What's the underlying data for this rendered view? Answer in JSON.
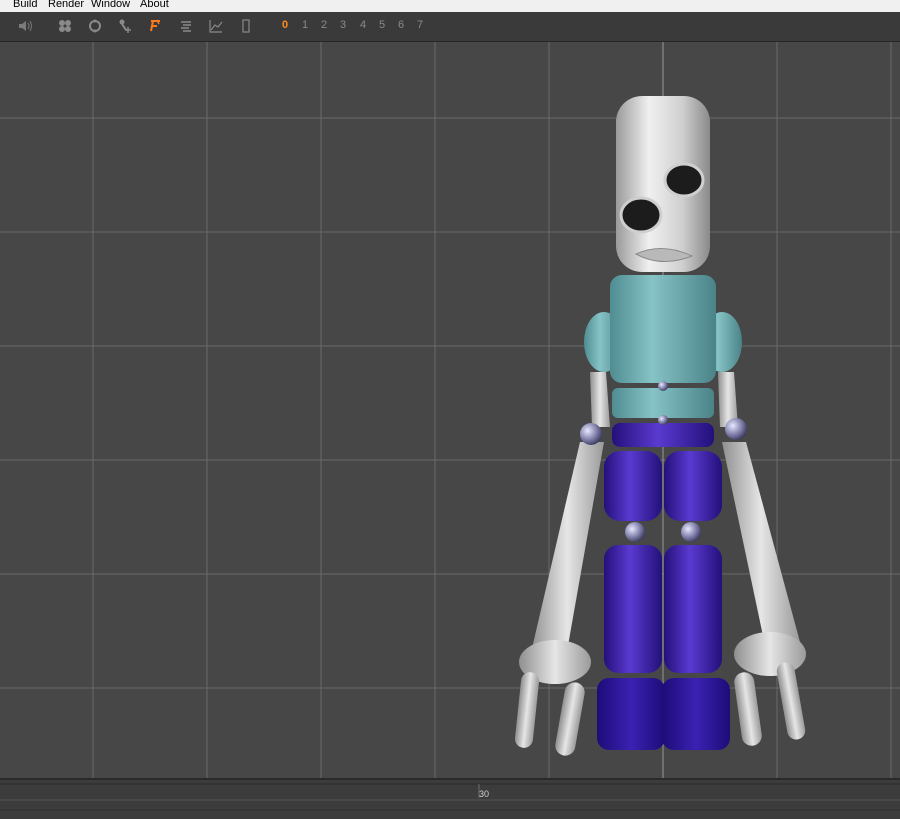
{
  "menu": {
    "items": [
      "Build",
      "Render",
      "Window",
      "About"
    ]
  },
  "toolbar": {
    "icons": [
      "speaker-icon",
      "grid-dots-icon",
      "orbit-icon",
      "add-bone-icon",
      "keyframe-icon",
      "layers-icon",
      "graph-icon",
      "frame-icon"
    ],
    "accent_color": "#ff7a1a"
  },
  "tabs": {
    "labels": [
      "0",
      "1",
      "2",
      "3",
      "4",
      "5",
      "6",
      "7"
    ],
    "active": "0"
  },
  "timeline": {
    "marker_label": "30"
  },
  "colors": {
    "viewport_bg": "#474747",
    "grid": "#6a6a6a",
    "head": "#d8d8d8",
    "torso": "#6fb0b4",
    "legs": "#3a1fa8",
    "feet": "#2a139a",
    "joints": "#8f8fb8"
  }
}
